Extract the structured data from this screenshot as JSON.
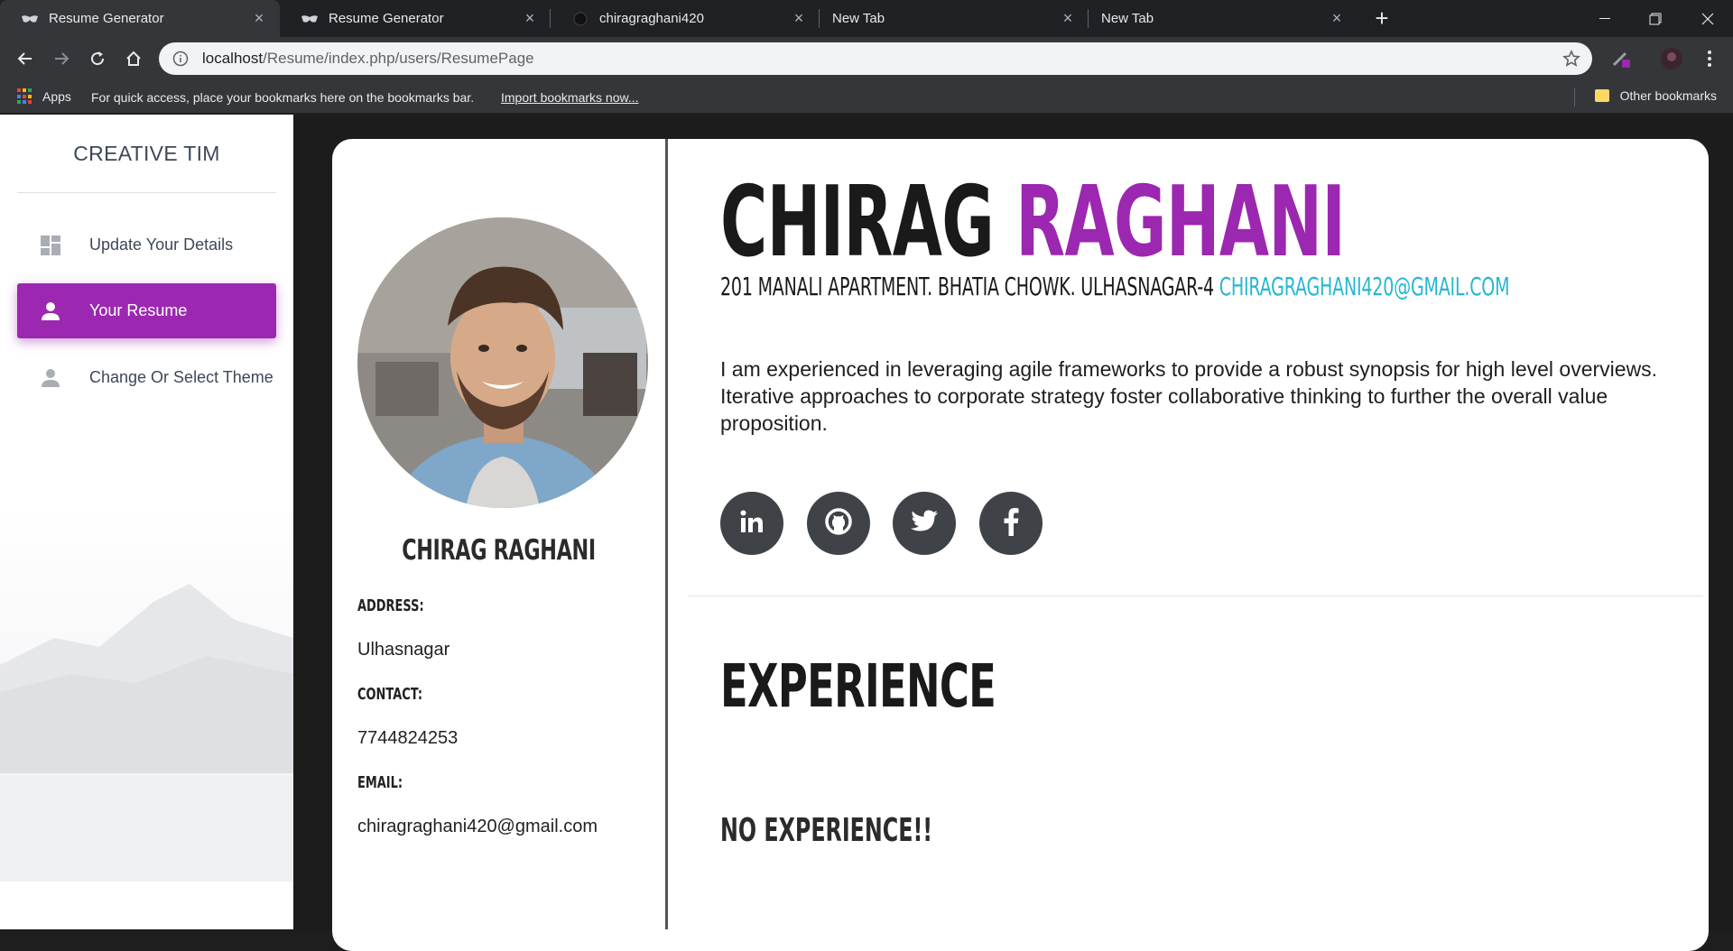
{
  "browser": {
    "tabs": [
      {
        "title": "Resume Generator",
        "active": true,
        "favicon": "mask-icon"
      },
      {
        "title": "Resume Generator",
        "active": false,
        "favicon": "mask-icon"
      },
      {
        "title": "chiragraghani420",
        "active": false,
        "favicon": "github-icon"
      },
      {
        "title": "New Tab",
        "active": false,
        "favicon": ""
      },
      {
        "title": "New Tab",
        "active": false,
        "favicon": ""
      }
    ],
    "url_host": "localhost",
    "url_path": "/Resume/index.php/users/ResumePage",
    "bookmarks_bar": {
      "apps_label": "Apps",
      "hint_text": "For quick access, place your bookmarks here on the bookmarks bar.",
      "import_link": "Import bookmarks now...",
      "other_bookmarks": "Other bookmarks"
    }
  },
  "sidebar": {
    "brand": "CREATIVE TIM",
    "items": [
      {
        "label": "Update Your Details",
        "icon": "dashboard-icon",
        "active": false
      },
      {
        "label": "Your Resume",
        "icon": "person-icon",
        "active": true
      },
      {
        "label": "Change Or Select Theme",
        "icon": "person-icon",
        "active": false
      }
    ]
  },
  "resume": {
    "first_name": "CHIRAG",
    "last_name": "RAGHANI",
    "address_line": "201 MANALI APARTMENT. BHATIA CHOWK. ULHASNAGAR-4",
    "email_upper": "CHIRAGRAGHANI420@GMAIL.COM",
    "summary": "I am experienced in leveraging agile frameworks to provide a robust synopsis for high level overviews. Iterative approaches to corporate strategy foster collaborative thinking to further the overall value proposition.",
    "social": [
      "linkedin-icon",
      "github-icon",
      "twitter-icon",
      "facebook-icon"
    ],
    "left_name": "CHIRAG RAGHANI",
    "address_label": "ADDRESS:",
    "address_value": "Ulhasnagar",
    "contact_label": "CONTACT:",
    "contact_value": "7744824253",
    "email_label": "EMAIL:",
    "email_value": "chiragraghani420@gmail.com",
    "experience_title": "EXPERIENCE",
    "no_experience": "NO EXPERIENCE!!"
  },
  "colors": {
    "accent": "#9c27b0",
    "email_link": "#26b7d0",
    "social_bg": "#3f4247"
  }
}
